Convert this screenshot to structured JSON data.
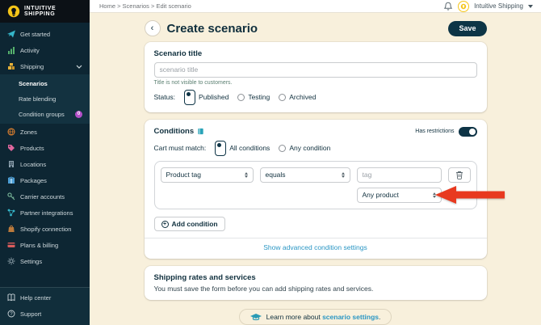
{
  "glyphs": {
    "back": "‹",
    "plus": "+",
    "question": "?"
  },
  "topbar": {
    "breadcrumb": "Home > Scenarios > Edit scenario",
    "account_label": "Intuitive Shipping"
  },
  "sidebar": {
    "logo_line1": "INTUITIVE",
    "logo_line2": "SHIPPING",
    "top_items": [
      {
        "label": "Get started"
      },
      {
        "label": "Activity"
      },
      {
        "label": "Shipping"
      }
    ],
    "sub_items": [
      {
        "label": "Scenarios"
      },
      {
        "label": "Rate blending"
      },
      {
        "label": "Condition groups",
        "badge": "0"
      }
    ],
    "mid_items": [
      {
        "label": "Zones"
      },
      {
        "label": "Products"
      },
      {
        "label": "Locations"
      },
      {
        "label": "Packages"
      },
      {
        "label": "Carrier accounts"
      },
      {
        "label": "Partner integrations"
      },
      {
        "label": "Shopify connection"
      },
      {
        "label": "Plans & billing"
      },
      {
        "label": "Settings"
      }
    ],
    "footer_items": [
      {
        "label": "Help center"
      },
      {
        "label": "Support"
      }
    ]
  },
  "header": {
    "title": "Create scenario",
    "save_label": "Save"
  },
  "scenario_card": {
    "title_label": "Scenario title",
    "input_placeholder": "scenario title",
    "helper": "Title is not visible to customers.",
    "status_label": "Status:",
    "options": [
      {
        "label": "Published",
        "selected": true
      },
      {
        "label": "Testing",
        "selected": false
      },
      {
        "label": "Archived",
        "selected": false
      }
    ]
  },
  "conditions_card": {
    "title": "Conditions",
    "has_restrictions_label": "Has restrictions",
    "toggle_on": true,
    "match_label": "Cart must match:",
    "match_options": [
      {
        "label": "All conditions",
        "selected": true
      },
      {
        "label": "Any condition",
        "selected": false
      }
    ],
    "row": {
      "field": "Product tag",
      "operator": "equals",
      "value_placeholder": "tag"
    },
    "scope_select": "Any product",
    "add_label": "Add condition",
    "advanced_link": "Show advanced condition settings"
  },
  "rates_card": {
    "title": "Shipping rates and services",
    "body": "You must save the form before you can add shipping rates and services."
  },
  "banner": {
    "prefix": "Learn more about ",
    "link": "scenario settings",
    "suffix": "."
  },
  "colors": {
    "navy": "#10303e",
    "button_navy": "#0d3546",
    "teal_link": "#2a96c4",
    "accent_teal": "#29a3b8",
    "cream_bg": "#f8f0dc",
    "sidebar_bg": "#0d2633",
    "arrow_red": "#e8391f",
    "badge_purple": "#b44fc8",
    "logo_yellow": "#f5c518"
  }
}
